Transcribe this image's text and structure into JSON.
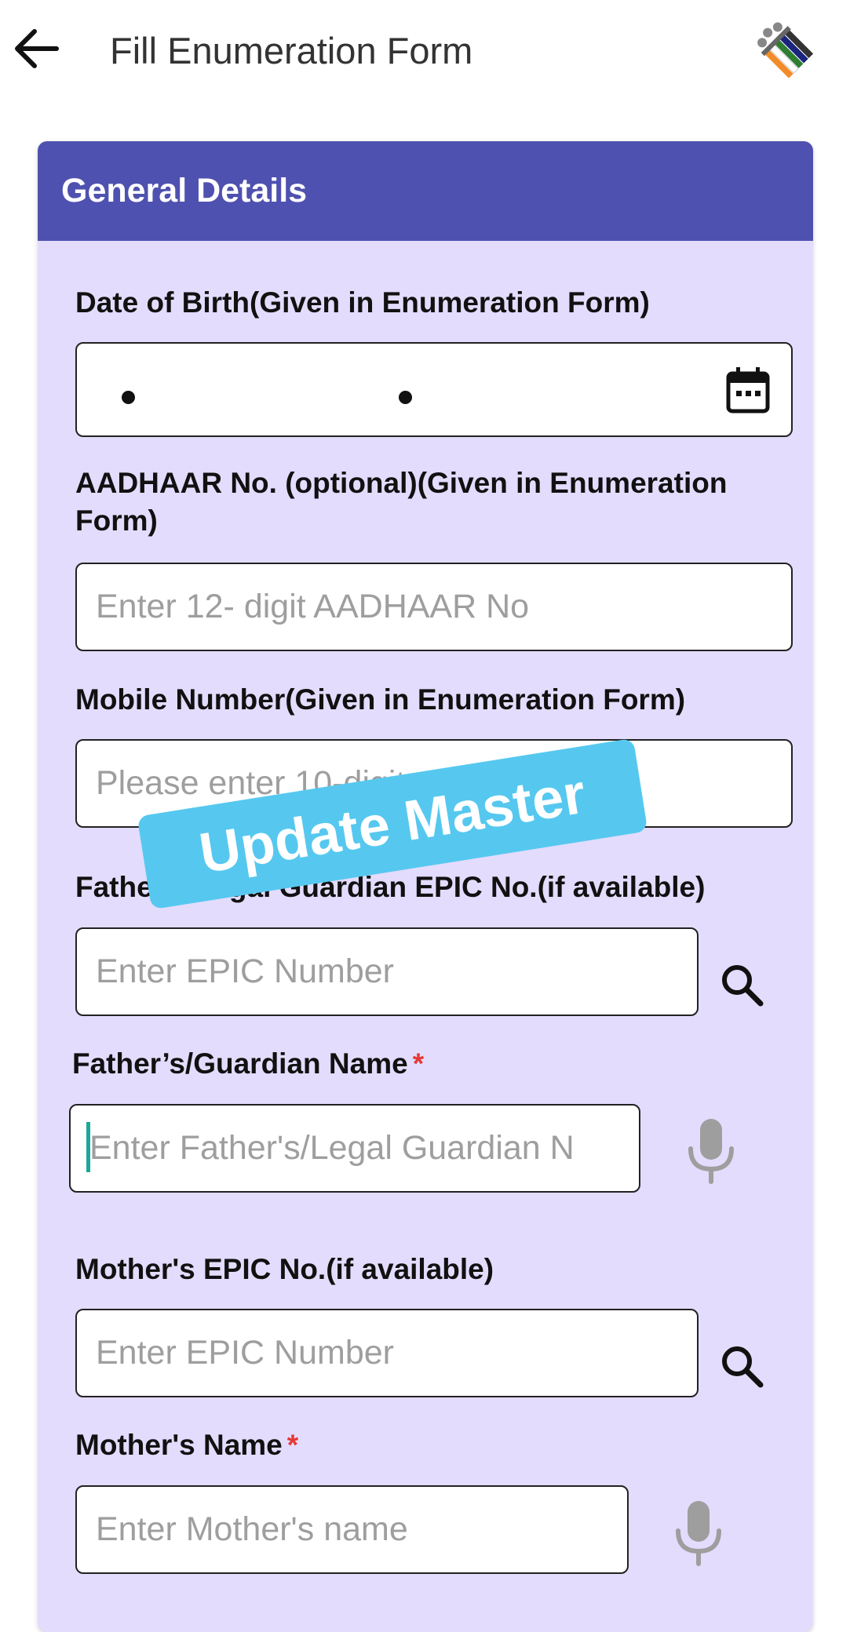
{
  "appbar": {
    "title": "Fill Enumeration Form",
    "back_icon": "arrow-left-icon",
    "logo_icon": "election-commission-logo"
  },
  "card": {
    "title": "General Details",
    "header_color": "#4f51b0",
    "background_color": "#e3dcfd"
  },
  "fields": {
    "dob": {
      "label": "Date of Birth(Given in Enumeration Form)",
      "value": "",
      "icon": "calendar-icon"
    },
    "aadhaar": {
      "label": "AADHAAR No. (optional)(Given in Enumeration Form)",
      "placeholder": "Enter 12- digit AADHAAR No"
    },
    "mobile": {
      "label": "Mobile Number(Given in Enumeration Form)",
      "placeholder": "Please enter 10-digit"
    },
    "father_epic": {
      "label": "Father's/Legal Guardian EPIC No.(if available)",
      "placeholder": "Enter EPIC Number",
      "icon": "search-icon"
    },
    "father_name": {
      "label": "Father’s/Guardian Name",
      "required_marker": "*",
      "placeholder": "Enter Father's/Legal Guardian N",
      "icon": "microphone-icon"
    },
    "mother_epic": {
      "label": "Mother's EPIC No.(if available)",
      "placeholder": "Enter EPIC Number",
      "icon": "search-icon"
    },
    "mother_name": {
      "label": "Mother's Name",
      "required_marker": "*",
      "placeholder": "Enter Mother's name",
      "icon": "microphone-icon"
    }
  },
  "watermark": {
    "text": "Update Master",
    "color": "#56c8ef"
  }
}
